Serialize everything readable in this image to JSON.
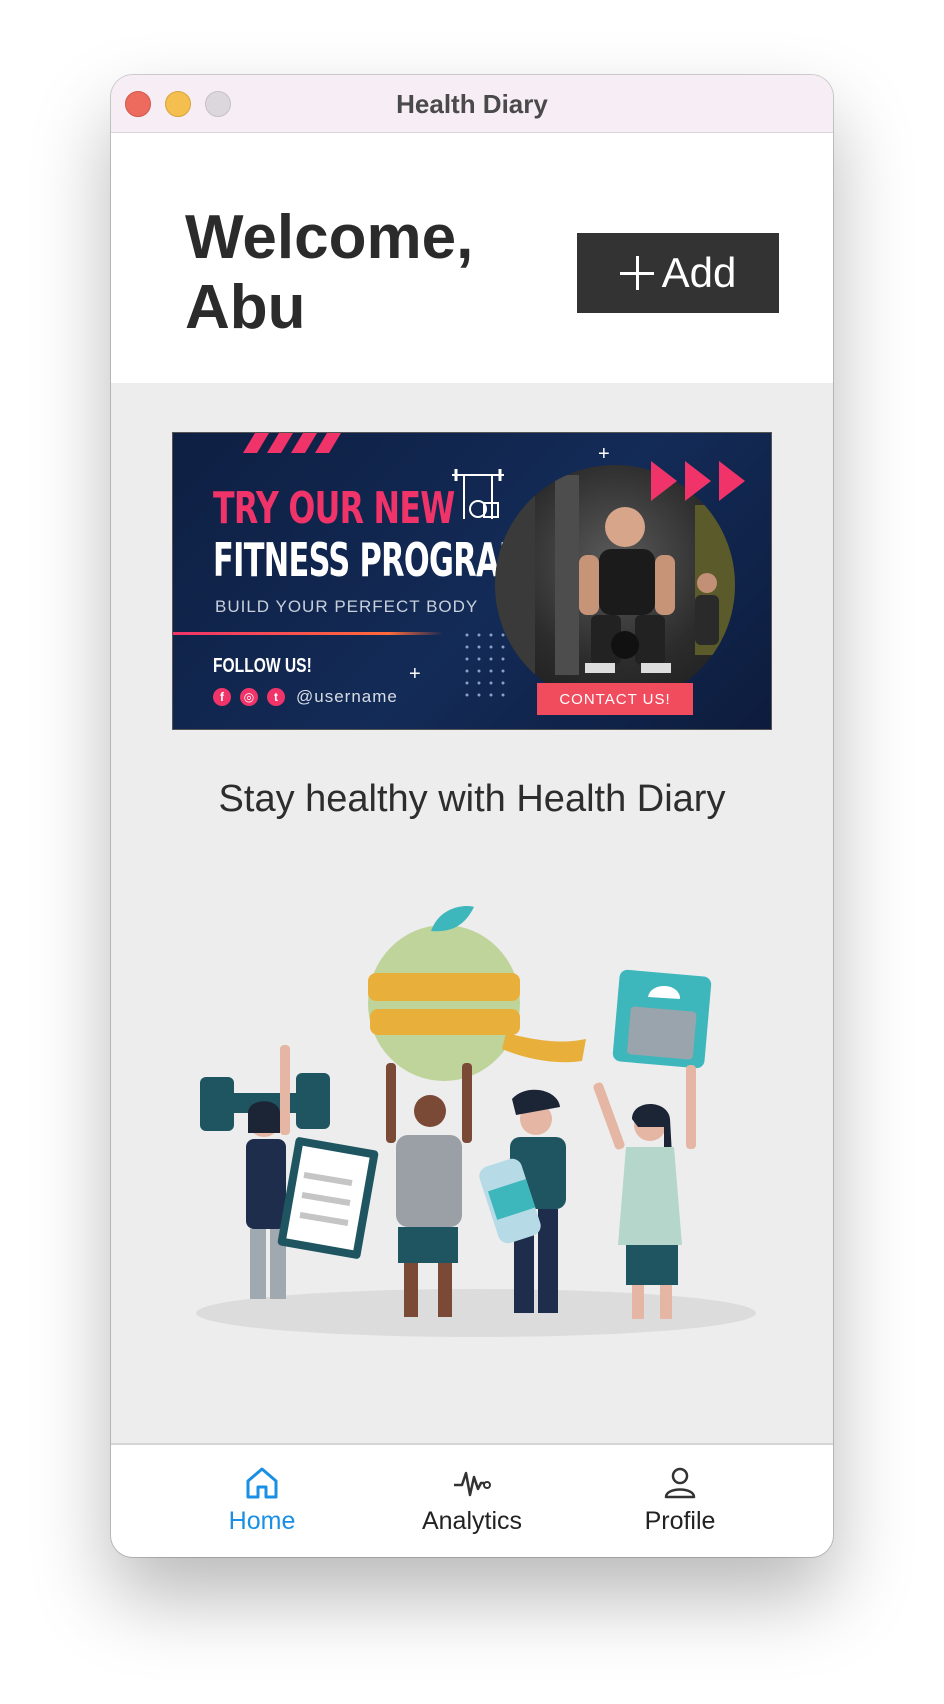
{
  "window": {
    "title": "Health Diary"
  },
  "header": {
    "greeting": "Welcome, Abu",
    "add_label": "Add"
  },
  "banner": {
    "line1": "TRY OUR NEW",
    "line2": "FITNESS PROGRAM",
    "line3": "BUILD YOUR PERFECT BODY",
    "follow": "FOLLOW US!",
    "handle": "@username",
    "contact": "CONTACT US!"
  },
  "main": {
    "tagline": "Stay healthy with Health Diary"
  },
  "tabs": [
    {
      "label": "Home",
      "icon": "home-icon",
      "active": true
    },
    {
      "label": "Analytics",
      "icon": "pulse-icon",
      "active": false
    },
    {
      "label": "Profile",
      "icon": "person-icon",
      "active": false
    }
  ],
  "colors": {
    "accent": "#1a8fe3",
    "button_bg": "#333333",
    "banner_pink": "#f0346a",
    "window_bg": "#ededee"
  }
}
